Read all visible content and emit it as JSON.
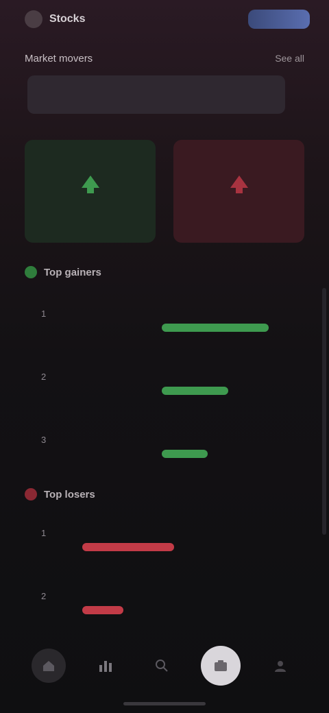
{
  "app": {
    "title": "Stocks",
    "action_pill": ""
  },
  "subheader": {
    "title": "Market movers",
    "link": "See all"
  },
  "banner": {
    "text": ""
  },
  "cards": [
    {
      "tone": "green",
      "label": "",
      "sub": ""
    },
    {
      "tone": "red",
      "label": "",
      "sub": ""
    }
  ],
  "gainers": {
    "title": "Top gainers",
    "rows": [
      {
        "rank": "1",
        "name": "",
        "value": "",
        "bar_pct": 42
      },
      {
        "rank": "2",
        "name": "",
        "value": "",
        "bar_pct": 26
      },
      {
        "rank": "3",
        "name": "",
        "value": "",
        "bar_pct": 18
      }
    ]
  },
  "losers": {
    "title": "Top losers",
    "rows": [
      {
        "rank": "1",
        "name": "",
        "value": "",
        "bar_pct": 36
      },
      {
        "rank": "2",
        "name": "",
        "value": "",
        "bar_pct": 16
      }
    ]
  },
  "colors": {
    "gain": "#4fba62",
    "loss": "#d24a55",
    "accent": "#5a6eb0"
  },
  "nav": [
    {
      "icon": "home-icon"
    },
    {
      "icon": "chart-icon"
    },
    {
      "icon": "search-icon"
    },
    {
      "icon": "portfolio-icon"
    },
    {
      "icon": "profile-icon"
    }
  ]
}
